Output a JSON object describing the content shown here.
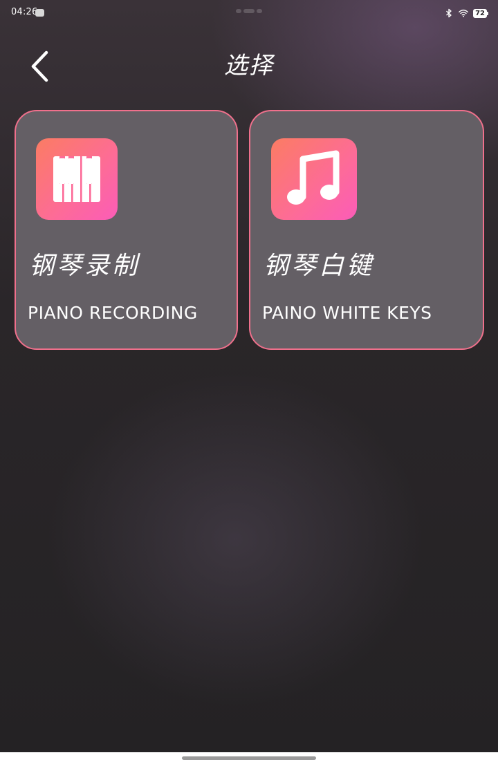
{
  "status_bar": {
    "time": "04:26",
    "battery": "72",
    "icons": [
      "app-notification-icon",
      "bluetooth-icon",
      "wifi-icon",
      "battery-icon"
    ]
  },
  "header": {
    "back_icon": "chevron-left-icon",
    "title": "选择"
  },
  "cards": [
    {
      "icon": "piano-keys-icon",
      "title": "钢琴录制",
      "subtitle": "PIANO RECORDING"
    },
    {
      "icon": "music-note-icon",
      "title": "钢琴白键",
      "subtitle": "PAINO WHITE KEYS"
    }
  ],
  "colors": {
    "card_background": "#645f65",
    "card_border": "#f0708c",
    "icon_gradient_start": "#fb7c63",
    "icon_gradient_end": "#fb5cb8",
    "text": "#ffffff"
  }
}
